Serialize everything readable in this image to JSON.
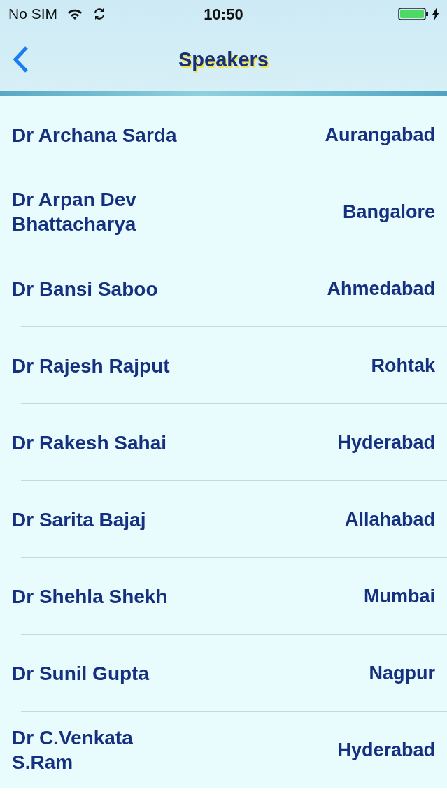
{
  "status_bar": {
    "carrier": "No SIM",
    "time": "10:50"
  },
  "nav": {
    "title": "Speakers"
  },
  "speakers": [
    {
      "name": "Dr Archana Sarda",
      "city": "Aurangabad"
    },
    {
      "name": "Dr Arpan Dev Bhattacharya",
      "city": "Bangalore"
    },
    {
      "name": "Dr Bansi Saboo",
      "city": "Ahmedabad"
    },
    {
      "name": "Dr Rajesh Rajput",
      "city": "Rohtak"
    },
    {
      "name": "Dr Rakesh Sahai",
      "city": "Hyderabad"
    },
    {
      "name": "Dr Sarita Bajaj",
      "city": "Allahabad"
    },
    {
      "name": "Dr Shehla Shekh",
      "city": "Mumbai"
    },
    {
      "name": "Dr Sunil Gupta",
      "city": "Nagpur"
    },
    {
      "name": "Dr C.Venkata S.Ram",
      "city": "Hyderabad"
    }
  ]
}
